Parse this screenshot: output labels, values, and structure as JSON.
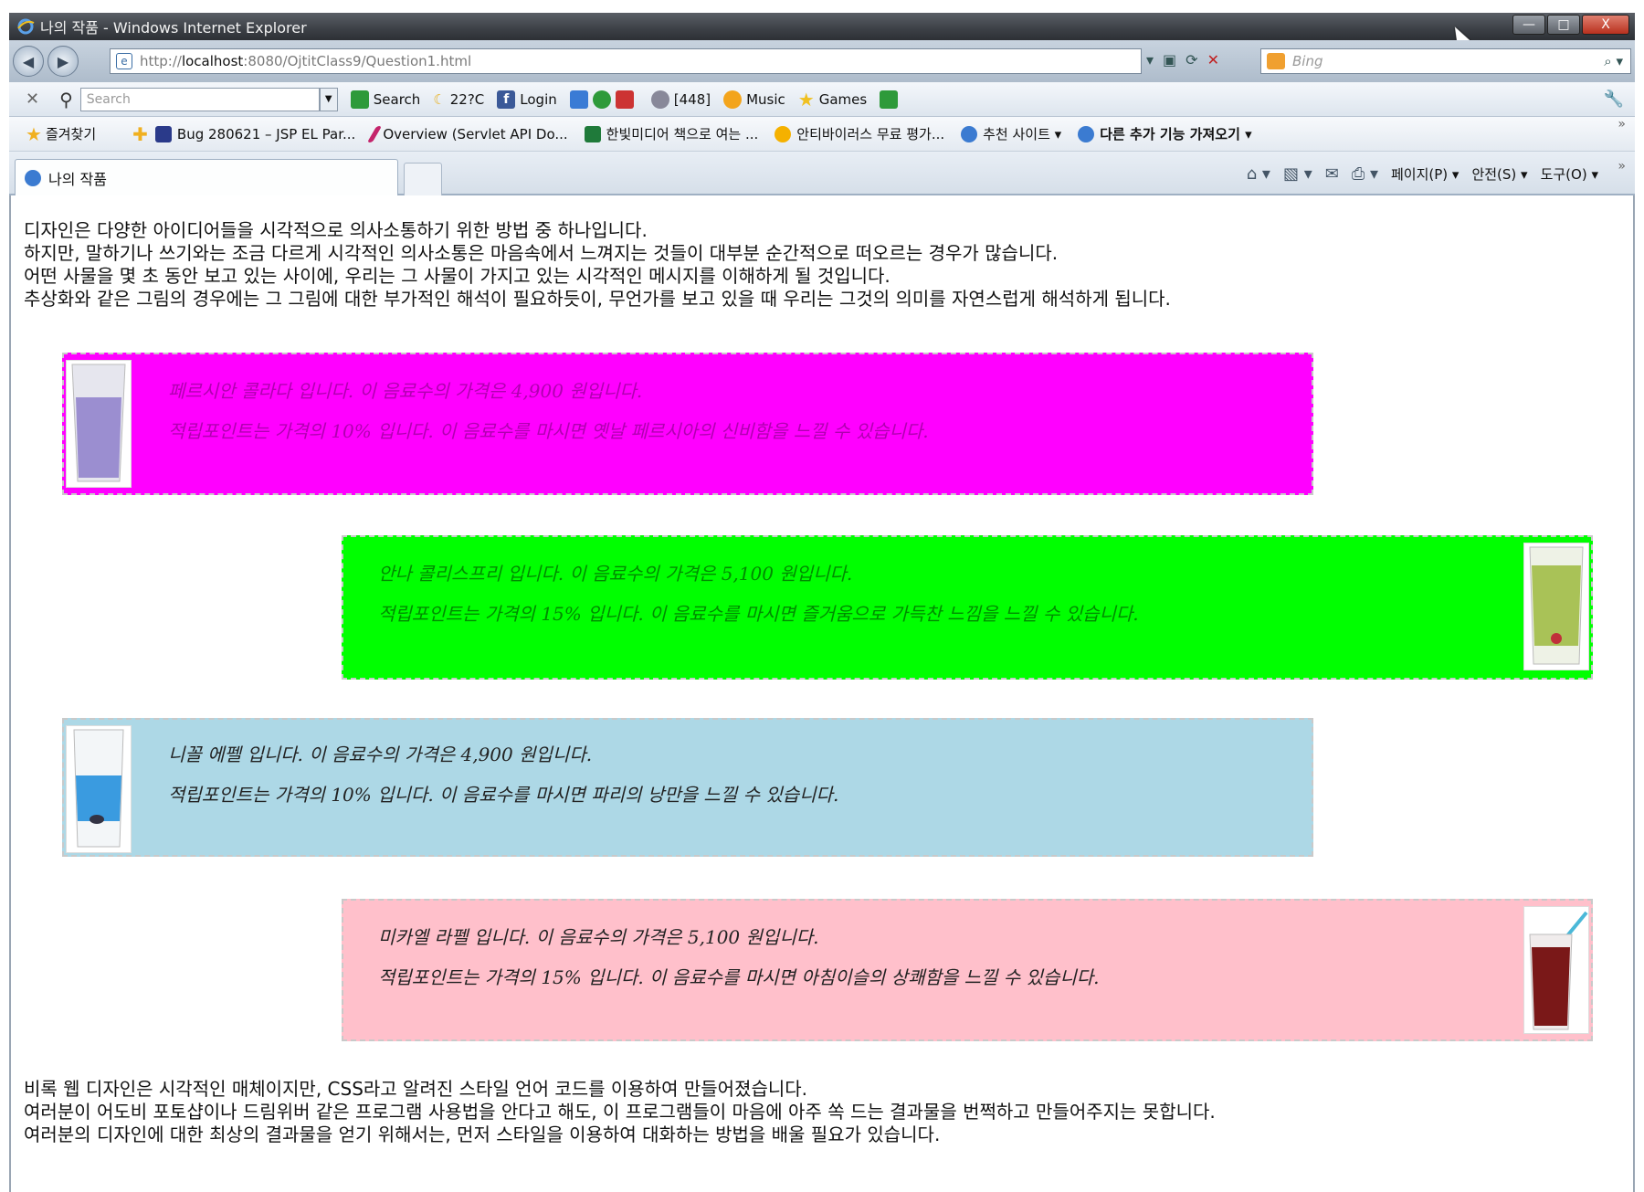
{
  "window": {
    "title": "나의 작품 - Windows Internet Explorer",
    "controls": {
      "minimize": "—",
      "maximize": "□",
      "close": "X"
    }
  },
  "addressbar": {
    "url_prefix": "http://",
    "url_host": "localhost",
    "url_rest": ":8080/OjtitClass9/Question1.html",
    "search_placeholder": "Bing"
  },
  "toolbar": {
    "search_placeholder": "Search",
    "items": [
      "Search",
      "22?C",
      "Login",
      "[448]",
      "Music",
      "Games"
    ]
  },
  "favorites": {
    "label": "즐겨찾기",
    "items": [
      "Bug 280621 – JSP EL Par...",
      "Overview (Servlet API Do...",
      "한빛미디어  책으로 여는 ...",
      "안티바이러스 무료 평가...",
      "추천 사이트 ▾",
      "다른 추가 기능 가져오기 ▾"
    ]
  },
  "tab": {
    "title": "나의 작품",
    "commands": [
      "페이지(P) ▾",
      "안전(S) ▾",
      "도구(O) ▾"
    ]
  },
  "content": {
    "intro": [
      "디자인은 다양한 아이디어들을 시각적으로 의사소통하기 위한 방법 중 하나입니다.",
      "하지만, 말하기나 쓰기와는 조금 다르게 시각적인 의사소통은 마음속에서 느껴지는 것들이 대부분 순간적으로 떠오르는 경우가 많습니다.",
      "어떤 사물을 몇 초 동안 보고 있는 사이에, 우리는 그 사물이 가지고 있는 시각적인 메시지를 이해하게 될 것입니다.",
      "추상화와 같은 그림의 경우에는 그 그림에 대한 부가적인 해석이 필요하듯이, 무언가를 보고 있을 때 우리는 그것의 의미를 자연스럽게 해석하게 됩니다."
    ],
    "drinks": [
      {
        "line1": "페르시안 콜라다 입니다. 이 음료수의 가격은 4,900 원입니다.",
        "line2": "적립포인트는 가격의 10% 입니다. 이 음료수를 마시면 옛날 페르시아의 신비함을 느낄 수 있습니다.",
        "bg": "#ff00ff",
        "text_color": "#b000b0",
        "glass": "purple-glass"
      },
      {
        "line1": "안나 콜리스프리 입니다. 이 음료수의 가격은 5,100 원입니다.",
        "line2": "적립포인트는 가격의 15% 입니다. 이 음료수를 마시면 즐거움으로 가득찬 느낌을 느낄 수 있습니다.",
        "bg": "#00ff00",
        "text_color": "#008a00",
        "glass": "green-glass"
      },
      {
        "line1": "니꼴 에펠 입니다. 이 음료수의 가격은 4,900 원입니다.",
        "line2": "적립포인트는 가격의 10% 입니다. 이 음료수를 마시면 파리의 낭만을 느낄 수 있습니다.",
        "bg": "#add8e6",
        "text_color": "#222222",
        "glass": "blue-glass"
      },
      {
        "line1": "미카엘 라펠 입니다. 이 음료수의 가격은 5,100 원입니다.",
        "line2": "적립포인트는 가격의 15% 입니다. 이 음료수를 마시면 아침이슬의 상쾌함을 느낄 수 있습니다.",
        "bg": "#ffc0cb",
        "text_color": "#222222",
        "glass": "red-glass"
      }
    ],
    "outro": [
      "비록 웹 디자인은 시각적인 매체이지만, CSS라고 알려진 스타일 언어 코드를 이용하여 만들어졌습니다.",
      "여러분이 어도비 포토샵이나 드림위버 같은 프로그램 사용법을 안다고 해도, 이 프로그램들이 마음에 아주 쏙 드는 결과물을 번쩍하고 만들어주지는 못합니다.",
      "여러분의 디자인에 대한 최상의 결과물을 얻기 위해서는, 먼저 스타일을 이용하여 대화하는 방법을 배울 필요가 있습니다."
    ]
  }
}
